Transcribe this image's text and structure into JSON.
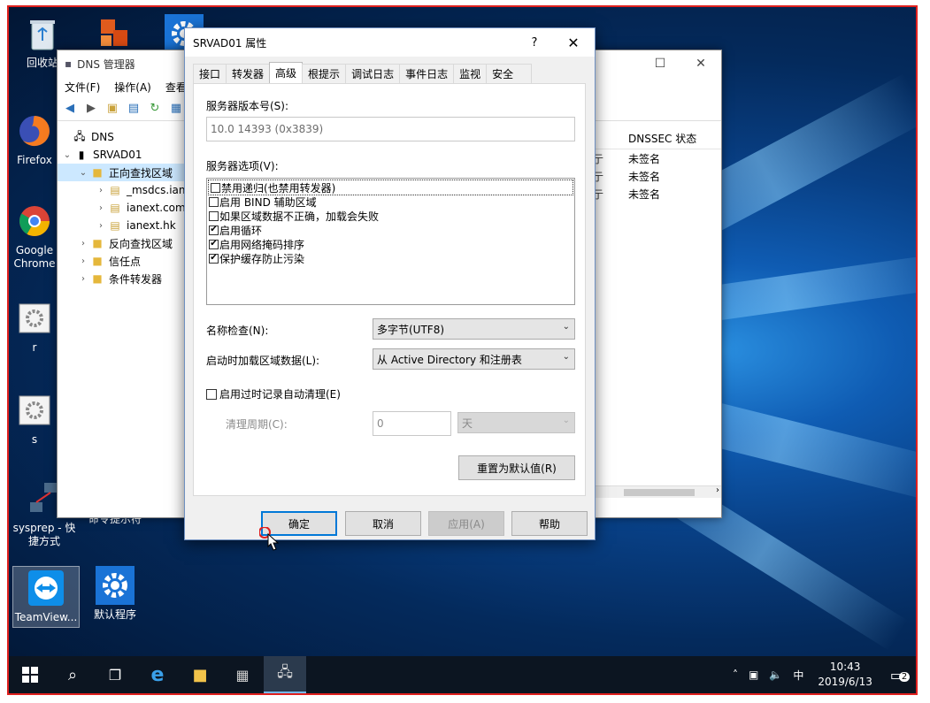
{
  "desktop": {
    "icons": [
      {
        "label": "回收站",
        "icon": "recycle-bin-icon"
      },
      {
        "label": "",
        "icon": "office-app-icon"
      },
      {
        "label": "",
        "icon": "gear-app-icon"
      },
      {
        "label": "Firefox",
        "icon": "firefox-icon"
      },
      {
        "label": "Google Chrome",
        "icon": "chrome-icon"
      },
      {
        "label": "r",
        "icon": "settings-shortcut-icon"
      },
      {
        "label": "s",
        "icon": "settings-shortcut-icon"
      },
      {
        "label": "sysprep - 快捷方式",
        "icon": "network-shortcut-icon"
      },
      {
        "label": "命令提示符",
        "icon": "cmd-icon"
      },
      {
        "label": "TeamView...",
        "icon": "teamviewer-icon"
      },
      {
        "label": "默认程序",
        "icon": "gear-app-icon"
      }
    ]
  },
  "dns_manager": {
    "title": "DNS 管理器",
    "menu": [
      "文件(F)",
      "操作(A)",
      "查看"
    ],
    "tree": [
      {
        "label": "DNS",
        "level": 0
      },
      {
        "label": "SRVAD01",
        "level": 1
      },
      {
        "label": "正向查找区域",
        "level": 2
      },
      {
        "label": "_msdcs.ian",
        "level": 3
      },
      {
        "label": "ianext.com",
        "level": 3
      },
      {
        "label": "ianext.hk",
        "level": 3
      },
      {
        "label": "反向查找区域",
        "level": 2
      },
      {
        "label": "信任点",
        "level": 2
      },
      {
        "label": "条件转发器",
        "level": 2
      }
    ],
    "column_header": "DNSSEC 状态",
    "partial_col": [
      "亍",
      "亍",
      "亍"
    ],
    "rows": [
      "未签名",
      "未签名",
      "未签名"
    ]
  },
  "dialog": {
    "title": "SRVAD01 属性",
    "help": "?",
    "tabs": [
      "接口",
      "转发器",
      "高级",
      "根提示",
      "调试日志",
      "事件日志",
      "监视",
      "安全"
    ],
    "active_tab": "高级",
    "version_label": "服务器版本号(S):",
    "version_value": "10.0 14393 (0x3839)",
    "options_label": "服务器选项(V):",
    "options": [
      {
        "label": "禁用递归(也禁用转发器)",
        "checked": false,
        "mark": ""
      },
      {
        "label": "启用 BIND 辅助区域",
        "checked": false,
        "mark": ""
      },
      {
        "label": "如果区域数据不正确，加载会失败",
        "checked": false,
        "mark": ""
      },
      {
        "label": "启用循环",
        "checked": true,
        "mark": "✔"
      },
      {
        "label": "启用网络掩码排序",
        "checked": true,
        "mark": "✔"
      },
      {
        "label": "保护缓存防止污染",
        "checked": true,
        "mark": "✔"
      }
    ],
    "name_check_label": "名称检查(N):",
    "name_check_value": "多字节(UTF8)",
    "load_zone_label": "启动时加载区域数据(L):",
    "load_zone_value": "从 Active Directory 和注册表",
    "scavenging_label": "启用过时记录自动清理(E)",
    "cleanup_label": "清理周期(C):",
    "cleanup_value": "0",
    "cleanup_unit": "天",
    "reset_button": "重置为默认值(R)",
    "ok": "确定",
    "cancel": "取消",
    "apply": "应用(A)",
    "help_button": "帮助"
  },
  "taskbar": {
    "time": "10:43",
    "date": "2019/6/13",
    "ime": "中",
    "notifications": "2"
  }
}
